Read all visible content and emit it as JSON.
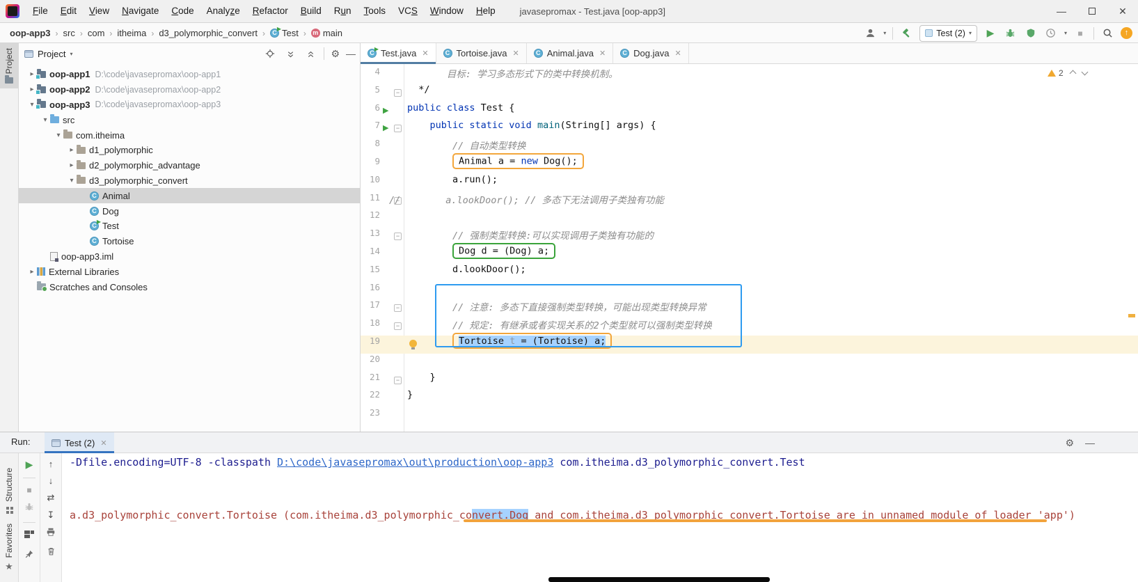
{
  "window": {
    "title": "javasepromax - Test.java [oop-app3]"
  },
  "menu": {
    "items": [
      {
        "label": "File",
        "m": 0
      },
      {
        "label": "Edit",
        "m": 0
      },
      {
        "label": "View",
        "m": 0
      },
      {
        "label": "Navigate",
        "m": 0
      },
      {
        "label": "Code",
        "m": 0
      },
      {
        "label": "Analyze",
        "m": 5
      },
      {
        "label": "Refactor",
        "m": 0
      },
      {
        "label": "Build",
        "m": 0
      },
      {
        "label": "Run",
        "m": 1
      },
      {
        "label": "Tools",
        "m": 0
      },
      {
        "label": "VCS",
        "m": 2
      },
      {
        "label": "Window",
        "m": 0
      },
      {
        "label": "Help",
        "m": 0
      }
    ]
  },
  "breadcrumbs": {
    "items": [
      {
        "label": "oop-app3",
        "bold": true
      },
      {
        "label": "src"
      },
      {
        "label": "com"
      },
      {
        "label": "itheima"
      },
      {
        "label": "d3_polymorphic_convert"
      },
      {
        "label": "Test",
        "icon": "class-run"
      },
      {
        "label": "main",
        "icon": "main"
      }
    ]
  },
  "toolbar": {
    "run_config": "Test (2)"
  },
  "left_stripe": {
    "project": "Project",
    "structure": "Structure",
    "favorites": "Favorites"
  },
  "project_panel": {
    "title": "Project",
    "tree": [
      {
        "depth": 0,
        "chevron": "collapsed",
        "icon": "module",
        "label": "oop-app1",
        "bold": true,
        "path": "D:\\code\\javasepromax\\oop-app1"
      },
      {
        "depth": 0,
        "chevron": "collapsed",
        "icon": "module",
        "label": "oop-app2",
        "bold": true,
        "path": "D:\\code\\javasepromax\\oop-app2"
      },
      {
        "depth": 0,
        "chevron": "expanded",
        "icon": "module",
        "label": "oop-app3",
        "bold": true,
        "path": "D:\\code\\javasepromax\\oop-app3"
      },
      {
        "depth": 1,
        "chevron": "expanded",
        "icon": "folder-src",
        "label": "src"
      },
      {
        "depth": 2,
        "chevron": "expanded",
        "icon": "package",
        "label": "com.itheima"
      },
      {
        "depth": 3,
        "chevron": "collapsed",
        "icon": "package",
        "label": "d1_polymorphic"
      },
      {
        "depth": 3,
        "chevron": "collapsed",
        "icon": "package",
        "label": "d2_polymorphic_advantage"
      },
      {
        "depth": 3,
        "chevron": "expanded",
        "icon": "package",
        "label": "d3_polymorphic_convert"
      },
      {
        "depth": 4,
        "chevron": "none",
        "icon": "class",
        "label": "Animal",
        "selected": true
      },
      {
        "depth": 4,
        "chevron": "none",
        "icon": "class",
        "label": "Dog"
      },
      {
        "depth": 4,
        "chevron": "none",
        "icon": "class-run",
        "label": "Test"
      },
      {
        "depth": 4,
        "chevron": "none",
        "icon": "class",
        "label": "Tortoise"
      },
      {
        "depth": 1,
        "chevron": "none",
        "icon": "iml",
        "label": "oop-app3.iml"
      },
      {
        "depth": 0,
        "chevron": "collapsed",
        "icon": "libraries",
        "label": "External Libraries"
      },
      {
        "depth": 0,
        "chevron": "none",
        "icon": "scratches",
        "label": "Scratches and Consoles"
      }
    ]
  },
  "editor": {
    "tabs": [
      {
        "label": "Test.java",
        "icon": "class-run",
        "active": true
      },
      {
        "label": "Tortoise.java",
        "icon": "class"
      },
      {
        "label": "Animal.java",
        "icon": "class"
      },
      {
        "label": "Dog.java",
        "icon": "class"
      }
    ],
    "inspections": {
      "warnings": "2"
    },
    "lines": [
      {
        "num": "4",
        "segs": [
          {
            "t": "       目标: 学习多态形式下的类中转换机制。",
            "c": "cmt"
          }
        ]
      },
      {
        "num": "5",
        "gutter": "fold",
        "segs": [
          {
            "t": "  */",
            "c": "plain"
          }
        ]
      },
      {
        "num": "6",
        "gutter": "run",
        "segs": [
          {
            "t": "public class ",
            "c": "kw"
          },
          {
            "t": "Test {",
            "c": "plain"
          }
        ]
      },
      {
        "num": "7",
        "gutter": "run fold",
        "segs": [
          {
            "t": "    ",
            "c": "plain"
          },
          {
            "t": "public static void ",
            "c": "kw"
          },
          {
            "t": "main",
            "c": "method"
          },
          {
            "t": "(String[] args) {",
            "c": "plain"
          }
        ]
      },
      {
        "num": "8",
        "segs": [
          {
            "t": "        ",
            "c": "plain"
          },
          {
            "t": "// 自动类型转换",
            "c": "cmt"
          }
        ]
      },
      {
        "num": "9",
        "segs": [
          {
            "t": "        ",
            "c": "plain"
          },
          {
            "box": "orange",
            "segs": [
              {
                "t": "Animal a = ",
                "c": "plain"
              },
              {
                "t": "new ",
                "c": "kw"
              },
              {
                "t": "Dog();",
                "c": "plain"
              }
            ]
          }
        ]
      },
      {
        "num": "10",
        "segs": [
          {
            "t": "        a.run();",
            "c": "plain"
          }
        ]
      },
      {
        "num": "11",
        "gutter": "fold",
        "segs": [
          {
            "t": "//",
            "c": "cmt outdent"
          },
          {
            "t": "        a.lookDoor(); // 多态下无法调用子类独有功能",
            "c": "cmt"
          }
        ]
      },
      {
        "num": "12",
        "segs": []
      },
      {
        "num": "13",
        "gutter": "fold",
        "segs": [
          {
            "t": "        ",
            "c": "plain"
          },
          {
            "t": "// 强制类型转换:可以实现调用子类独有功能的",
            "c": "cmt"
          }
        ]
      },
      {
        "num": "14",
        "segs": [
          {
            "t": "        ",
            "c": "plain"
          },
          {
            "box": "green",
            "segs": [
              {
                "t": "Dog d = (Dog) a;",
                "c": "plain"
              }
            ]
          }
        ]
      },
      {
        "num": "15",
        "segs": [
          {
            "t": "        d.lookDoor();",
            "c": "plain"
          }
        ]
      },
      {
        "num": "16",
        "segs": []
      },
      {
        "num": "17",
        "gutter": "fold",
        "segs": [
          {
            "t": "        ",
            "c": "plain"
          },
          {
            "t": "// 注意: 多态下直接强制类型转换，可能出现类型转换异常",
            "c": "cmt"
          }
        ]
      },
      {
        "num": "18",
        "gutter": "fold",
        "segs": [
          {
            "t": "        ",
            "c": "plain"
          },
          {
            "t": "// 规定: 有继承或者实现关系的2个类型就可以强制类型转换",
            "c": "cmt"
          }
        ]
      },
      {
        "num": "19",
        "gutter": "bulb",
        "hl": true,
        "segs": [
          {
            "t": "        ",
            "c": "plain"
          },
          {
            "box": "orange",
            "segs": [
              {
                "t": "Tortoise ",
                "c": "plain sel"
              },
              {
                "t": "t",
                "c": "unused sel"
              },
              {
                "t": " = (Tortoise) a;",
                "c": "plain sel"
              }
            ]
          }
        ]
      },
      {
        "num": "20",
        "segs": []
      },
      {
        "num": "21",
        "gutter": "fold",
        "segs": [
          {
            "t": "    }",
            "c": "plain"
          }
        ]
      },
      {
        "num": "22",
        "segs": [
          {
            "t": "}",
            "c": "plain"
          }
        ]
      },
      {
        "num": "23",
        "segs": []
      }
    ]
  },
  "run_panel": {
    "label": "Run:",
    "tab": "Test (2)",
    "console": [
      {
        "segs": [
          {
            "t": "-Dfile.encoding=UTF-8 -classpath ",
            "c": "stdout"
          },
          {
            "t": "D:\\code\\javasepromax\\out\\production\\oop-app3",
            "c": "link"
          },
          {
            "t": " com.itheima.d3_polymorphic_convert.Test",
            "c": "stdout"
          }
        ]
      },
      {
        "segs": [
          {
            "t": "a.d3_polymorphic_convert.Tortoise (com.itheima.d3_polymorphic_co",
            "c": "err"
          },
          {
            "t": "nvert.Dog",
            "c": "err selblue"
          },
          {
            "t": " and com.itheima.d3_polymorphic_convert.Tortoise are in unnamed module of loader 'app')",
            "c": "err"
          }
        ]
      }
    ]
  },
  "annotations": {
    "boxes": [
      {
        "color": "#F3A63B",
        "target": "line-9"
      },
      {
        "color": "#3AA33A",
        "target": "line-14"
      },
      {
        "color": "#2E9BF0",
        "target": "lines-17-19"
      },
      {
        "color": "#F3A63B",
        "target": "line-19"
      },
      {
        "color": "#F2A33C",
        "target": "console-error-underline"
      }
    ],
    "selection_color": "#A6D2FF",
    "error_color": "#A8423A"
  }
}
